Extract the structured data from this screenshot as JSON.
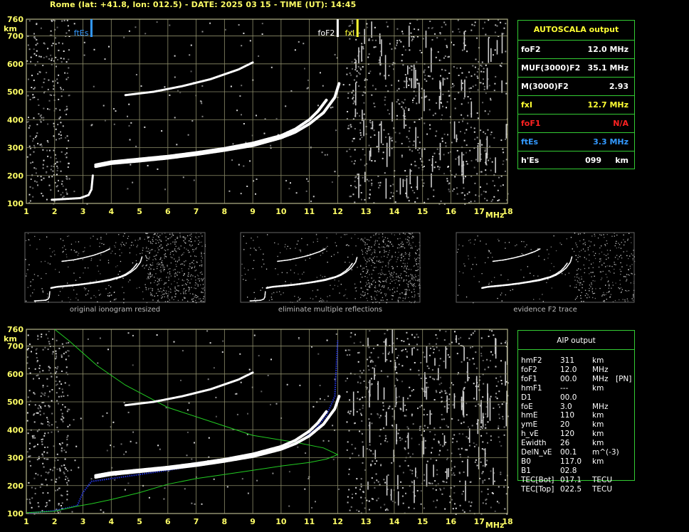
{
  "header": {
    "title": "Rome (lat: +41.8, lon: 012.5) - DATE: 2025 03 15 - TIME (UT): 14:45"
  },
  "colors": {
    "grid": "#8c8c6a",
    "frame": "#b5b58a",
    "tick_label": "#ffff66",
    "trace": "#ffffff",
    "noise": "#777777",
    "profile": "#22cc22",
    "fit": "#2233dd",
    "table_border": "#33cc33",
    "table_title": "#ffff33",
    "es": "#3399ff",
    "fxi": "#ffff33",
    "na": "#ff2222"
  },
  "chart_data": [
    {
      "type": "scatter",
      "name": "autoscala-ionogram",
      "x_ticks": [
        "1",
        "2",
        "3",
        "4",
        "5",
        "6",
        "7",
        "8",
        "9",
        "10",
        "11",
        "12",
        "13",
        "14",
        "15",
        "16",
        "17",
        "18"
      ],
      "y_ticks": [
        "100",
        "200",
        "300",
        "400",
        "500",
        "600",
        "700",
        "760"
      ],
      "xlabel": "MHz",
      "ylabel": "km",
      "xlim": [
        1,
        18
      ],
      "ylim": [
        100,
        760
      ],
      "grid": true,
      "markers": [
        {
          "label": "ftEs",
          "x": 3.3,
          "color": "#3399ff"
        },
        {
          "label": "foF2",
          "x": 12.0,
          "color": "#ffffff"
        },
        {
          "label": "fxI",
          "x": 12.7,
          "color": "#ffff33"
        }
      ],
      "series": [
        {
          "points": [
            [
              3.45,
              232
            ],
            [
              4,
              243
            ],
            [
              5,
              252
            ],
            [
              6,
              262
            ],
            [
              7,
              275
            ],
            [
              8,
              290
            ],
            [
              9,
              307
            ],
            [
              10,
              335
            ],
            [
              10.5,
              355
            ],
            [
              11,
              385
            ],
            [
              11.5,
              425
            ],
            [
              11.9,
              480
            ],
            [
              12.05,
              530
            ]
          ]
        },
        {
          "points": [
            [
              3.45,
              238
            ],
            [
              4,
              249
            ],
            [
              5,
              259
            ],
            [
              6,
              269
            ],
            [
              7,
              282
            ],
            [
              8,
              297
            ],
            [
              9,
              316
            ],
            [
              10,
              343
            ],
            [
              10.5,
              366
            ],
            [
              11,
              400
            ],
            [
              11.3,
              430
            ],
            [
              11.6,
              470
            ]
          ]
        },
        {
          "points": [
            [
              4.5,
              488
            ],
            [
              5.5,
              500
            ],
            [
              6.5,
              520
            ],
            [
              7.5,
              545
            ],
            [
              8.5,
              580
            ],
            [
              9,
              605
            ]
          ]
        },
        {
          "points": [
            [
              1.9,
              113
            ],
            [
              2.4,
              116
            ],
            [
              2.9,
              119
            ],
            [
              3.2,
              130
            ],
            [
              3.3,
              150
            ],
            [
              3.35,
              200
            ]
          ]
        }
      ]
    },
    {
      "type": "scatter",
      "name": "preprocessing-thumbnails",
      "captions": [
        "original ionogram resized",
        "eliminate multiple reflections",
        "evidence F2 trace"
      ]
    },
    {
      "type": "line",
      "name": "aip-ionogram",
      "x_ticks": [
        "1",
        "2",
        "3",
        "4",
        "5",
        "6",
        "7",
        "8",
        "9",
        "10",
        "11",
        "12",
        "13",
        "14",
        "15",
        "16",
        "17",
        "18"
      ],
      "y_ticks": [
        "100",
        "200",
        "300",
        "400",
        "500",
        "600",
        "700",
        "760"
      ],
      "xlabel": "MHz",
      "ylabel": "km",
      "xlim": [
        1,
        18
      ],
      "ylim": [
        100,
        760
      ],
      "grid": true,
      "series": [
        {
          "points": [
            [
              1.1,
              102
            ],
            [
              2,
              110
            ],
            [
              2.8,
              128
            ],
            [
              3,
              175
            ],
            [
              3.3,
              215
            ],
            [
              4,
              225
            ],
            [
              5,
              240
            ],
            [
              6,
              255
            ],
            [
              7,
              272
            ],
            [
              8,
              288
            ],
            [
              9,
              305
            ],
            [
              10,
              330
            ],
            [
              10.7,
              360
            ],
            [
              11.2,
              400
            ],
            [
              11.6,
              450
            ],
            [
              11.9,
              520
            ],
            [
              12,
              720
            ]
          ]
        },
        {
          "points": [
            [
              1,
              103
            ],
            [
              2,
              108
            ],
            [
              2.6,
              122
            ],
            [
              2.9,
              128
            ],
            [
              3.3,
              135
            ],
            [
              4,
              150
            ],
            [
              5,
              175
            ],
            [
              6,
              205
            ],
            [
              7,
              225
            ],
            [
              8,
              240
            ],
            [
              9,
              255
            ],
            [
              10,
              270
            ],
            [
              11,
              283
            ],
            [
              11.6,
              295
            ],
            [
              12,
              311
            ],
            [
              11.5,
              335
            ],
            [
              10.5,
              355
            ],
            [
              9,
              380
            ],
            [
              7.5,
              430
            ],
            [
              6,
              480
            ],
            [
              4.5,
              560
            ],
            [
              3.5,
              630
            ],
            [
              2.5,
              720
            ],
            [
              2,
              760
            ]
          ]
        },
        {
          "points": [
            [
              3.45,
              230
            ],
            [
              4,
              240
            ],
            [
              5,
              250
            ],
            [
              6,
              260
            ],
            [
              7,
              272
            ],
            [
              8,
              287
            ],
            [
              9,
              304
            ],
            [
              10,
              330
            ],
            [
              10.5,
              350
            ],
            [
              11,
              378
            ],
            [
              11.5,
              420
            ],
            [
              11.9,
              475
            ],
            [
              12.05,
              520
            ]
          ]
        },
        {
          "points": [
            [
              3.45,
              236
            ],
            [
              4,
              246
            ],
            [
              5,
              256
            ],
            [
              6,
              266
            ],
            [
              7,
              279
            ],
            [
              8,
              294
            ],
            [
              9,
              313
            ],
            [
              10,
              340
            ],
            [
              10.5,
              362
            ],
            [
              11,
              395
            ],
            [
              11.3,
              425
            ],
            [
              11.6,
              465
            ]
          ]
        },
        {
          "points": [
            [
              4.5,
              488
            ],
            [
              5.5,
              500
            ],
            [
              6.5,
              520
            ],
            [
              7.5,
              545
            ],
            [
              8.5,
              580
            ],
            [
              9,
              605
            ]
          ]
        }
      ]
    }
  ],
  "autoscala": {
    "title": "AUTOSCALA output",
    "rows": [
      {
        "label": "foF2",
        "value": "12.0 MHz",
        "color": "#ffffff"
      },
      {
        "label": "MUF(3000)F2",
        "value": "35.1 MHz",
        "color": "#ffffff"
      },
      {
        "label": "M(3000)F2",
        "value": "2.93",
        "color": "#ffffff"
      },
      {
        "label": "fxI",
        "value": "12.7 MHz",
        "color": "#ffff33"
      },
      {
        "label": "foF1",
        "value": "N/A",
        "color": "#ff2222"
      },
      {
        "label": "ftEs",
        "value": "3.3 MHz",
        "color": "#3399ff"
      },
      {
        "label": "h'Es",
        "value": "099     km",
        "color": "#ffffff"
      }
    ]
  },
  "aip": {
    "title": "AIP output",
    "rows": [
      {
        "label": "hmF2",
        "value": "311",
        "unit": "km",
        "extra": ""
      },
      {
        "label": "foF2",
        "value": "12.0",
        "unit": "MHz",
        "extra": ""
      },
      {
        "label": "foF1",
        "value": "00.0",
        "unit": "MHz",
        "extra": "[PN]"
      },
      {
        "label": "hmF1",
        "value": "---",
        "unit": "km",
        "extra": ""
      },
      {
        "label": "D1",
        "value": "00.0",
        "unit": "",
        "extra": ""
      },
      {
        "label": "foE",
        "value": "3.0",
        "unit": "MHz",
        "extra": ""
      },
      {
        "label": "hmE",
        "value": "110",
        "unit": "km",
        "extra": ""
      },
      {
        "label": "ymE",
        "value": "20",
        "unit": "km",
        "extra": ""
      },
      {
        "label": "h_vE",
        "value": "120",
        "unit": "km",
        "extra": ""
      },
      {
        "label": "Ewidth",
        "value": "26",
        "unit": "km",
        "extra": ""
      },
      {
        "label": "DelN_vE",
        "value": "00.1",
        "unit": "m^(-3)",
        "extra": ""
      },
      {
        "label": "B0",
        "value": "117.0",
        "unit": "km",
        "extra": ""
      },
      {
        "label": "B1",
        "value": "02.8",
        "unit": "",
        "extra": ""
      },
      {
        "label": "TEC[Bot]",
        "value": "017.1",
        "unit": "TECU",
        "extra": ""
      },
      {
        "label": "TEC[Top]",
        "value": "022.5",
        "unit": "TECU",
        "extra": ""
      }
    ]
  }
}
